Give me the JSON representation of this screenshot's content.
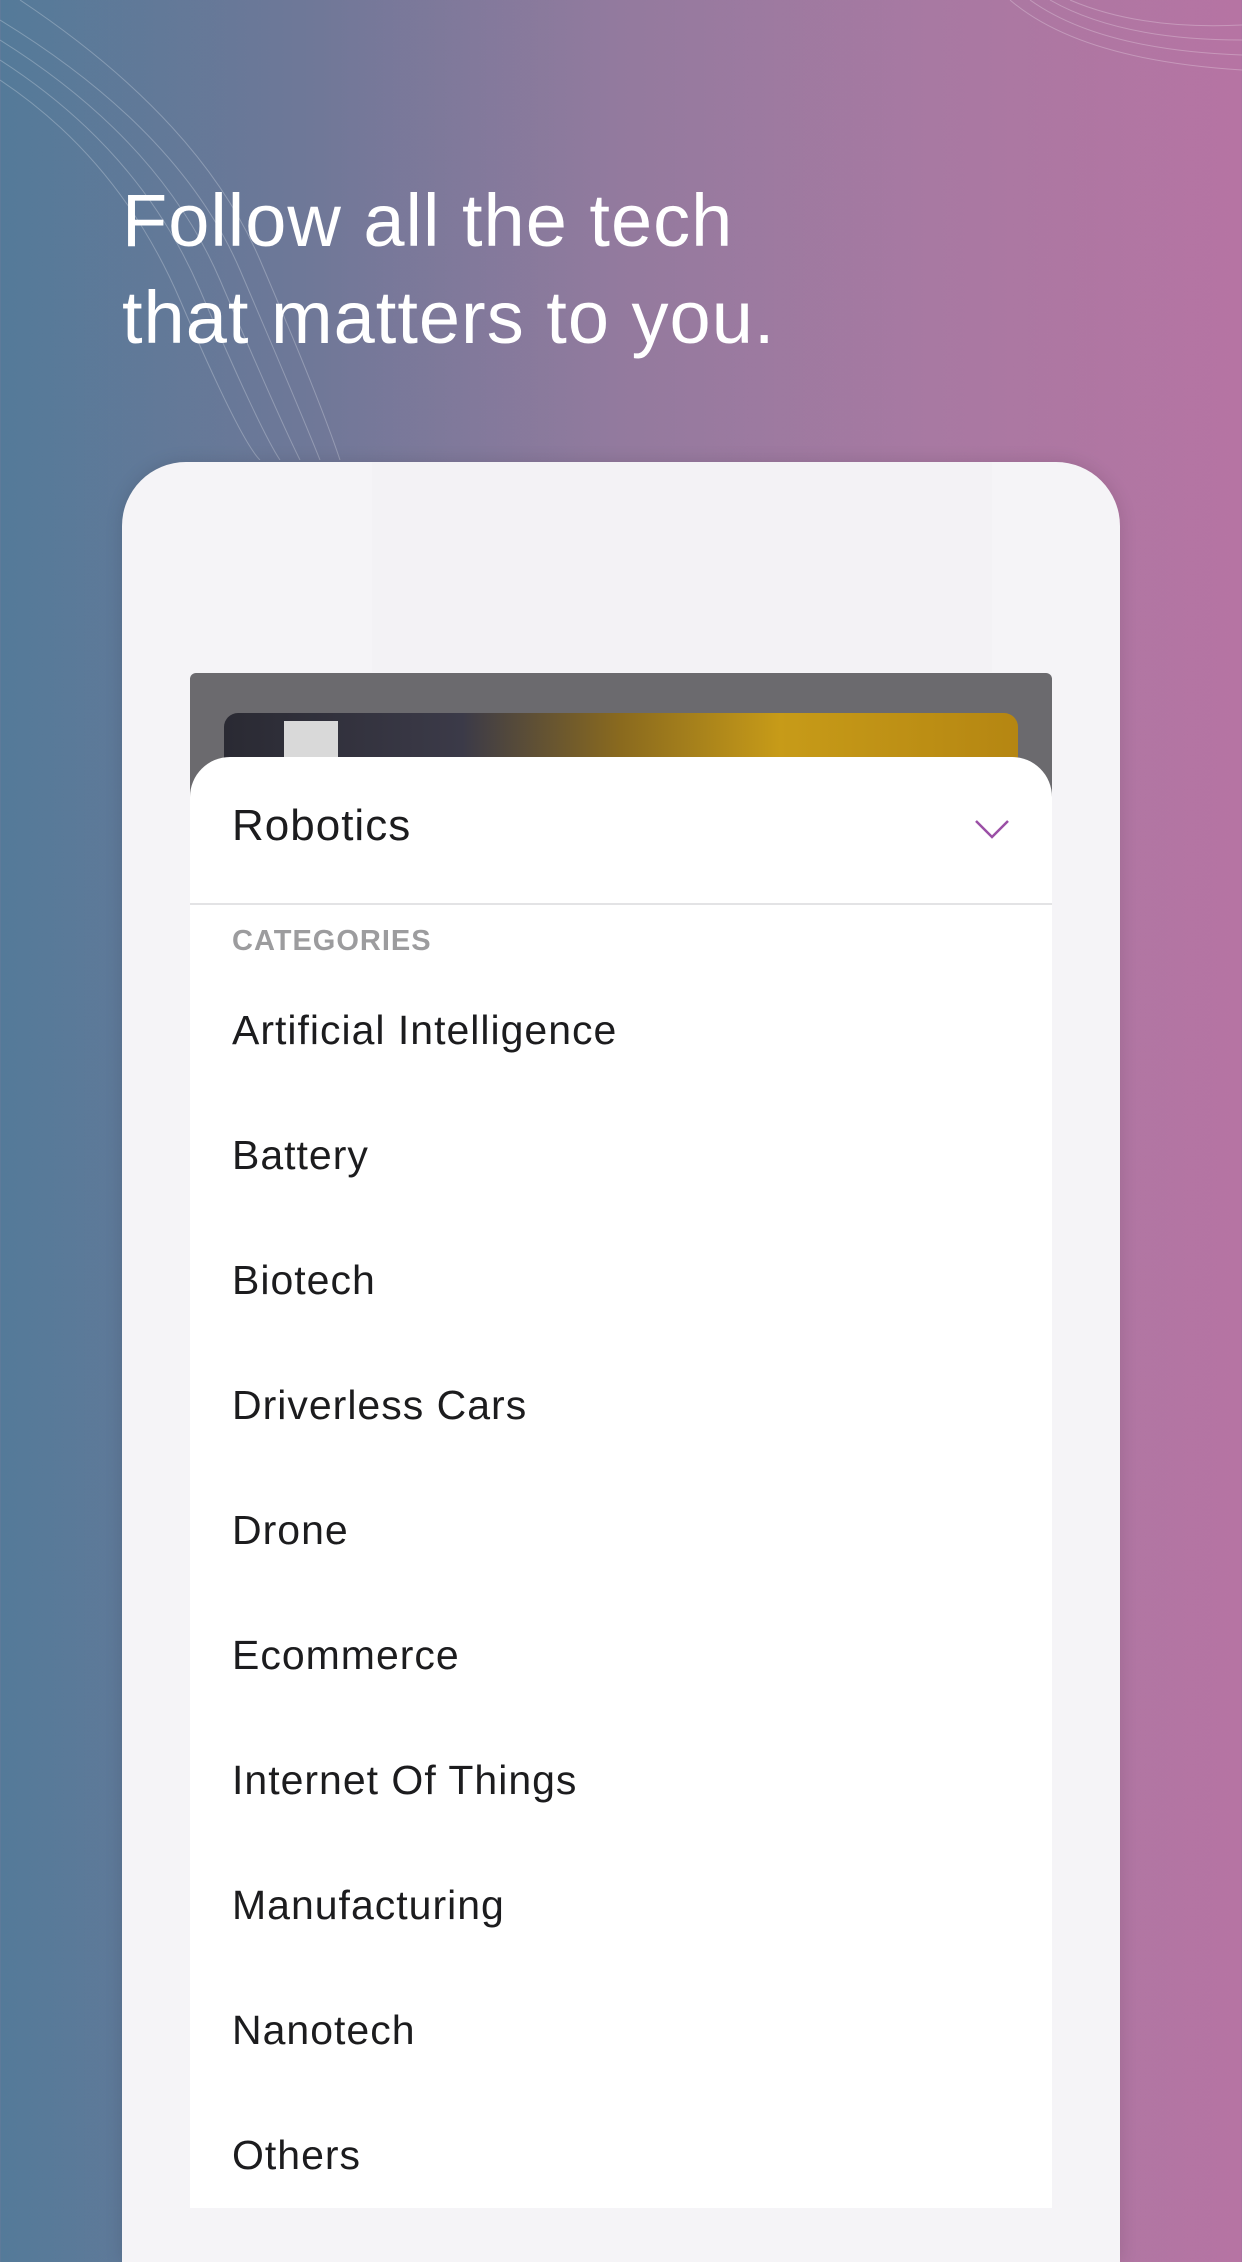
{
  "headline": {
    "line1": "Follow all the tech",
    "line2": "that matters to you."
  },
  "dropdown": {
    "selected": "Robotics",
    "section_label": "CATEGORIES",
    "items": [
      "Artificial Intelligence",
      "Battery",
      "Biotech",
      "Driverless Cars",
      "Drone",
      "Ecommerce",
      "Internet Of Things",
      "Manufacturing",
      "Nanotech",
      "Others"
    ]
  },
  "colors": {
    "accent": "#9b4fa6",
    "background_left": "#547a99",
    "background_right": "#b674a3"
  },
  "icons": {
    "dropdown_toggle": "chevron-down-icon"
  }
}
